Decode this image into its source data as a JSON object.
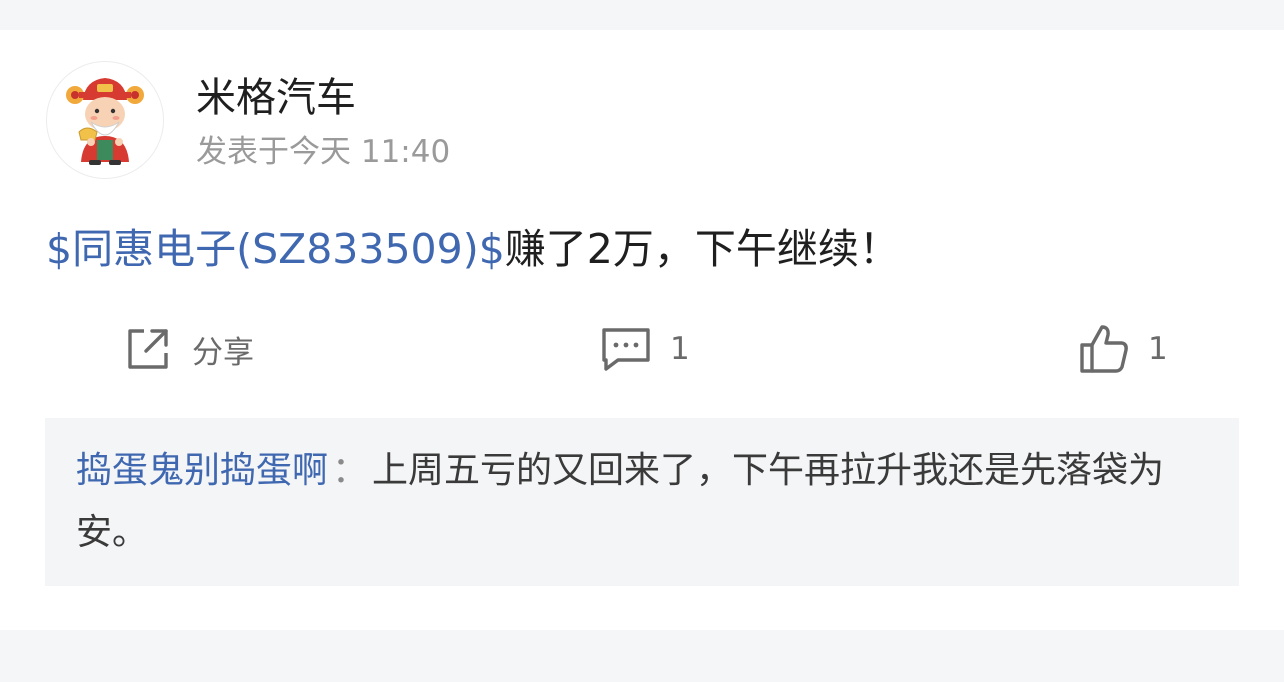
{
  "post": {
    "author": "米格汽车",
    "time": "发表于今天 11:40",
    "stock_link": "$同惠电子(SZ833509)$",
    "text": "赚了2万，下午继续！"
  },
  "actions": {
    "share_label": "分享",
    "comment_count": "1",
    "like_count": "1"
  },
  "reply": {
    "author": "捣蛋鬼别捣蛋啊",
    "separator": "：",
    "text": "上周五亏的又回来了，下午再拉升我还是先落袋为安。"
  },
  "colors": {
    "link": "#3f68b0",
    "text": "#1f1f1f",
    "muted": "#9a9a9a",
    "reply_bg": "#f4f5f7"
  },
  "icons": {
    "avatar": "caishen-avatar",
    "share": "share-icon",
    "comment": "comment-icon",
    "like": "thumbs-up-icon"
  }
}
